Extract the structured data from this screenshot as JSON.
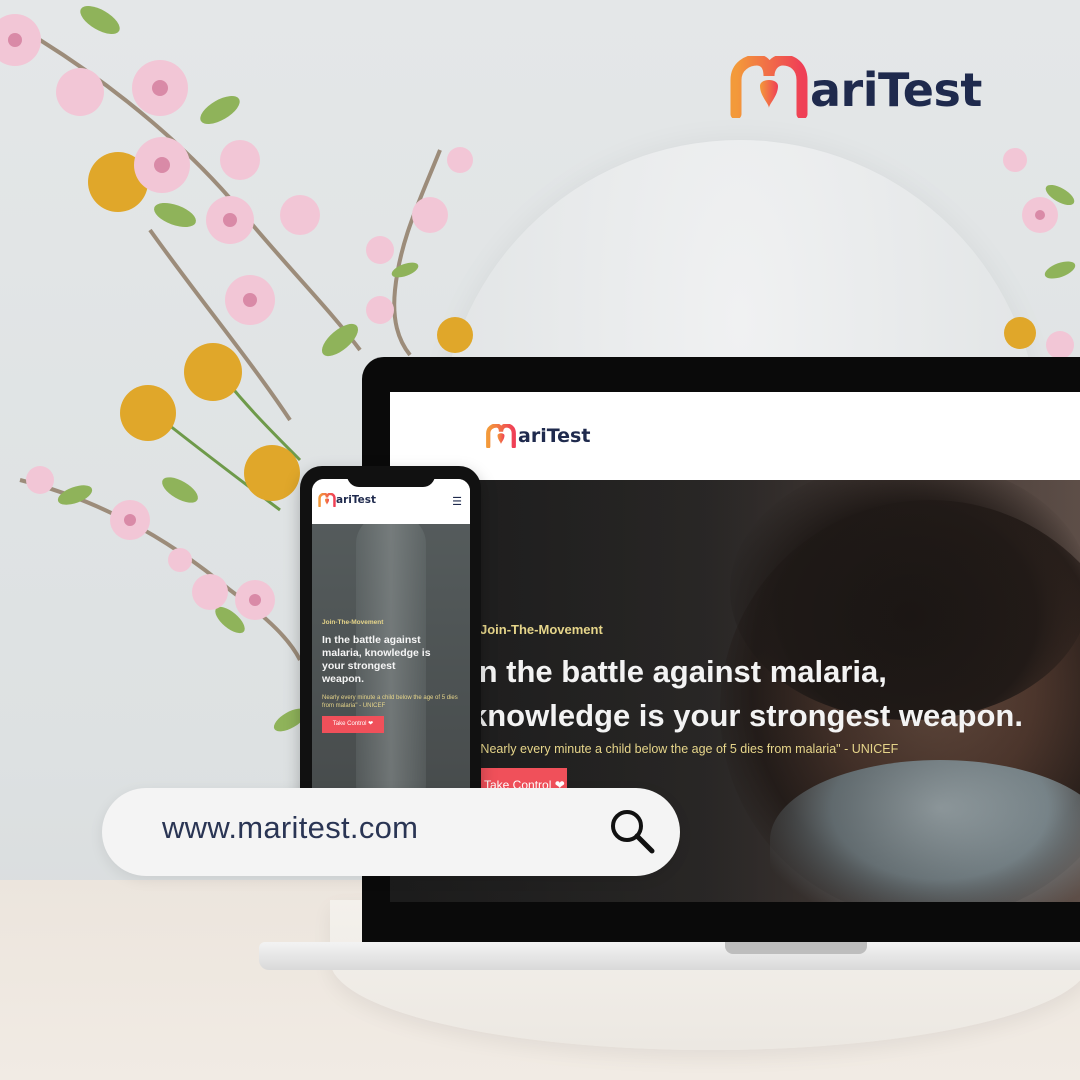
{
  "brand": {
    "name": "MariTest",
    "logo_text": "ariTest",
    "colors": {
      "accent_orange": "#f39a3a",
      "accent_red": "#ef3f56",
      "navy": "#1f2a4d"
    }
  },
  "laptop": {
    "logo_text": "ariTest",
    "hero": {
      "tag": "Join-The-Movement",
      "title_line1": "In the battle against malaria,",
      "title_line2": "knowledge is your strongest weapon.",
      "quote": "\"Nearly every minute a child below the age of 5 dies from malaria\" - UNICEF",
      "button_label": "Take Control ❤"
    }
  },
  "phone": {
    "logo_text": "ariTest",
    "menu_icon": "hamburger-icon",
    "hero": {
      "tag": "Join-The-Movement",
      "title": "In the battle against malaria, knowledge is your strongest weapon.",
      "quote": "Nearly every minute a child below the age of 5 dies from malaria\" - UNICEF",
      "button_label": "Take Control ❤"
    }
  },
  "search": {
    "url": "www.maritest.com",
    "icon": "search-icon"
  }
}
